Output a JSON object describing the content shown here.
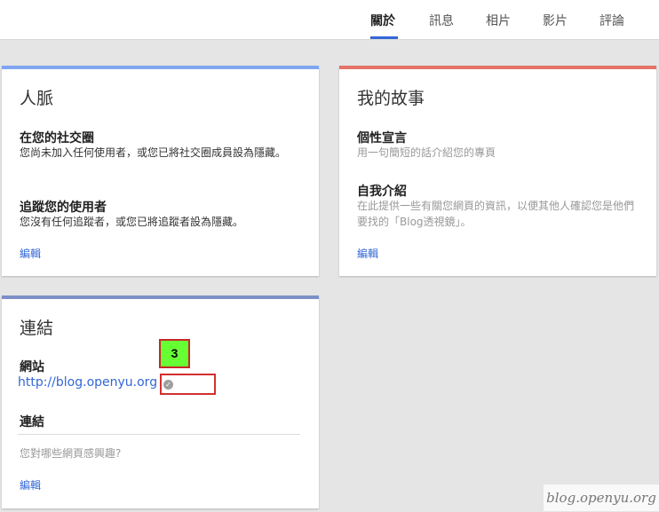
{
  "colors": {
    "people_accent": "#80a6f2",
    "story_accent": "#e57368",
    "links_accent": "#7e8fc7",
    "link": "#3367d6",
    "active_tab_underline": "#3367d6",
    "annotation_red": "#d32f2f",
    "annotation_green": "#66ff33"
  },
  "tabs": [
    {
      "label": "關於",
      "active": true
    },
    {
      "label": "訊息",
      "active": false
    },
    {
      "label": "相片",
      "active": false
    },
    {
      "label": "影片",
      "active": false
    },
    {
      "label": "評論",
      "active": false
    }
  ],
  "people_card": {
    "title": "人脈",
    "circles_heading": "在您的社交圈",
    "circles_text": "您尚未加入任何使用者，或您已將社交圈成員設為隱藏。",
    "followers_heading": "追蹤您的使用者",
    "followers_text": "您沒有任何追蹤者，或您已將追蹤者設為隱藏。",
    "edit": "編輯"
  },
  "story_card": {
    "title": "我的故事",
    "tagline_heading": "個性宣言",
    "tagline_placeholder": "用一句簡短的話介紹您的專頁",
    "intro_heading": "自我介紹",
    "intro_placeholder": "在此提供一些有關您網頁的資訊，以便其他人確認您是他們要找的「Blog透視鏡」。",
    "edit": "編輯"
  },
  "links_card": {
    "title": "連結",
    "website_heading": "網站",
    "website_url": "http://blog.openyu.org",
    "verified_icon": "check-circle-icon",
    "links_heading": "連結",
    "links_placeholder": "您對哪些網頁感興趣?",
    "edit": "編輯"
  },
  "annotation": {
    "badge": "3"
  },
  "watermark": "blog.openyu.org"
}
